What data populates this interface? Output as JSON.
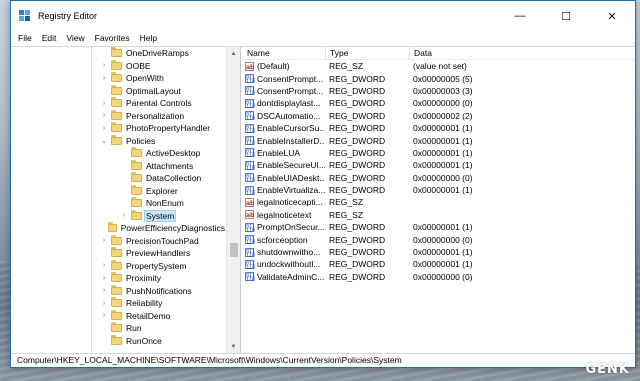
{
  "window": {
    "title": "Registry Editor",
    "controls": {
      "minimize": "—",
      "maximize": "☐",
      "close": "✕"
    }
  },
  "menu": [
    "File",
    "Edit",
    "View",
    "Favorites",
    "Help"
  ],
  "tree": [
    {
      "label": "OneDriveRamps",
      "expander": "",
      "indent": 0
    },
    {
      "label": "OOBE",
      "expander": "›",
      "indent": 0
    },
    {
      "label": "OpenWith",
      "expander": "›",
      "indent": 0
    },
    {
      "label": "OptimalLayout",
      "expander": "",
      "indent": 0
    },
    {
      "label": "Parental Controls",
      "expander": "›",
      "indent": 0
    },
    {
      "label": "Personalization",
      "expander": "›",
      "indent": 0
    },
    {
      "label": "PhotoPropertyHandler",
      "expander": "›",
      "indent": 0
    },
    {
      "label": "Policies",
      "expander": "⌄",
      "indent": 0
    },
    {
      "label": "ActiveDesktop",
      "expander": "",
      "indent": 1
    },
    {
      "label": "Attachments",
      "expander": "",
      "indent": 1
    },
    {
      "label": "DataCollection",
      "expander": "",
      "indent": 1
    },
    {
      "label": "Explorer",
      "expander": "",
      "indent": 1
    },
    {
      "label": "NonEnum",
      "expander": "",
      "indent": 1
    },
    {
      "label": "System",
      "expander": "›",
      "indent": 1,
      "selected": true
    },
    {
      "label": "PowerEfficiencyDiagnostics",
      "expander": "",
      "indent": 0
    },
    {
      "label": "PrecisionTouchPad",
      "expander": "›",
      "indent": 0
    },
    {
      "label": "PreviewHandlers",
      "expander": "",
      "indent": 0
    },
    {
      "label": "PropertySystem",
      "expander": "›",
      "indent": 0
    },
    {
      "label": "Proximity",
      "expander": "›",
      "indent": 0
    },
    {
      "label": "PushNotifications",
      "expander": "›",
      "indent": 0
    },
    {
      "label": "Reliability",
      "expander": "›",
      "indent": 0
    },
    {
      "label": "RetailDemo",
      "expander": "›",
      "indent": 0
    },
    {
      "label": "Run",
      "expander": "",
      "indent": 0
    },
    {
      "label": "RunOnce",
      "expander": "",
      "indent": 0
    }
  ],
  "columns": {
    "name": "Name",
    "type": "Type",
    "data": "Data"
  },
  "values": [
    {
      "icon": "ab",
      "name": "(Default)",
      "type": "REG_SZ",
      "data": "(value not set)"
    },
    {
      "icon": "bin",
      "name": "ConsentPrompt...",
      "type": "REG_DWORD",
      "data": "0x00000005 (5)"
    },
    {
      "icon": "bin",
      "name": "ConsentPrompt...",
      "type": "REG_DWORD",
      "data": "0x00000003 (3)"
    },
    {
      "icon": "bin",
      "name": "dontdisplaylast...",
      "type": "REG_DWORD",
      "data": "0x00000000 (0)"
    },
    {
      "icon": "bin",
      "name": "DSCAutomatio...",
      "type": "REG_DWORD",
      "data": "0x00000002 (2)"
    },
    {
      "icon": "bin",
      "name": "EnableCursorSu...",
      "type": "REG_DWORD",
      "data": "0x00000001 (1)"
    },
    {
      "icon": "bin",
      "name": "EnableInstallerD...",
      "type": "REG_DWORD",
      "data": "0x00000001 (1)"
    },
    {
      "icon": "bin",
      "name": "EnableLUA",
      "type": "REG_DWORD",
      "data": "0x00000001 (1)"
    },
    {
      "icon": "bin",
      "name": "EnableSecureUI...",
      "type": "REG_DWORD",
      "data": "0x00000001 (1)"
    },
    {
      "icon": "bin",
      "name": "EnableUIADeskt...",
      "type": "REG_DWORD",
      "data": "0x00000000 (0)"
    },
    {
      "icon": "bin",
      "name": "EnableVirtualiza...",
      "type": "REG_DWORD",
      "data": "0x00000001 (1)"
    },
    {
      "icon": "ab",
      "name": "legalnoticecapti...",
      "type": "REG_SZ",
      "data": ""
    },
    {
      "icon": "ab",
      "name": "legalnoticetext",
      "type": "REG_SZ",
      "data": ""
    },
    {
      "icon": "bin",
      "name": "PromptOnSecur...",
      "type": "REG_DWORD",
      "data": "0x00000001 (1)"
    },
    {
      "icon": "bin",
      "name": "scforceoption",
      "type": "REG_DWORD",
      "data": "0x00000000 (0)"
    },
    {
      "icon": "bin",
      "name": "shutdownwitho...",
      "type": "REG_DWORD",
      "data": "0x00000001 (1)"
    },
    {
      "icon": "bin",
      "name": "undockwithoutl...",
      "type": "REG_DWORD",
      "data": "0x00000001 (1)"
    },
    {
      "icon": "bin",
      "name": "ValidateAdminC...",
      "type": "REG_DWORD",
      "data": "0x00000000 (0)"
    }
  ],
  "icon_glyphs": {
    "ab": "ab",
    "bin": "011\n110"
  },
  "status_path": "Computer\\HKEY_LOCAL_MACHINE\\SOFTWARE\\Microsoft\\Windows\\CurrentVersion\\Policies\\System",
  "watermark": "GENK",
  "colors": {
    "selection": "#cce8ff",
    "folder": "#f5d57a",
    "window_border": "#1f6fb5"
  }
}
